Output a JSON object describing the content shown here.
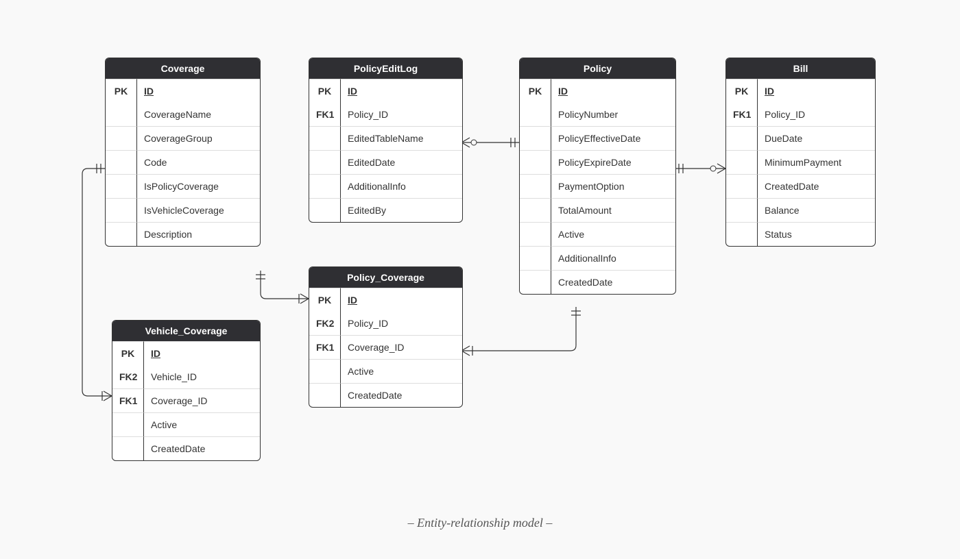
{
  "caption": "– Entity-relationship model –",
  "entities": {
    "coverage": {
      "title": "Coverage",
      "pk": {
        "key": "PK",
        "name": "ID"
      },
      "attrs": [
        {
          "key": "",
          "name": "CoverageName"
        },
        {
          "key": "",
          "name": "CoverageGroup"
        },
        {
          "key": "",
          "name": "Code"
        },
        {
          "key": "",
          "name": "IsPolicyCoverage"
        },
        {
          "key": "",
          "name": "IsVehicleCoverage"
        },
        {
          "key": "",
          "name": "Description"
        }
      ]
    },
    "policyEditLog": {
      "title": "PolicyEditLog",
      "pk": {
        "key": "PK",
        "name": "ID"
      },
      "attrs": [
        {
          "key": "FK1",
          "name": "Policy_ID"
        },
        {
          "key": "",
          "name": "EditedTableName"
        },
        {
          "key": "",
          "name": "EditedDate"
        },
        {
          "key": "",
          "name": "AdditionalInfo"
        },
        {
          "key": "",
          "name": "EditedBy"
        }
      ]
    },
    "policy": {
      "title": "Policy",
      "pk": {
        "key": "PK",
        "name": "ID"
      },
      "attrs": [
        {
          "key": "",
          "name": "PolicyNumber"
        },
        {
          "key": "",
          "name": "PolicyEffectiveDate"
        },
        {
          "key": "",
          "name": "PolicyExpireDate"
        },
        {
          "key": "",
          "name": "PaymentOption"
        },
        {
          "key": "",
          "name": "TotalAmount"
        },
        {
          "key": "",
          "name": "Active"
        },
        {
          "key": "",
          "name": "AdditionalInfo"
        },
        {
          "key": "",
          "name": "CreatedDate"
        }
      ]
    },
    "bill": {
      "title": "Bill",
      "pk": {
        "key": "PK",
        "name": "ID"
      },
      "attrs": [
        {
          "key": "FK1",
          "name": "Policy_ID"
        },
        {
          "key": "",
          "name": "DueDate"
        },
        {
          "key": "",
          "name": "MinimumPayment"
        },
        {
          "key": "",
          "name": "CreatedDate"
        },
        {
          "key": "",
          "name": "Balance"
        },
        {
          "key": "",
          "name": "Status"
        }
      ]
    },
    "vehicleCoverage": {
      "title": "Vehicle_Coverage",
      "pk": {
        "key": "PK",
        "name": "ID"
      },
      "attrs": [
        {
          "key": "FK2",
          "name": "Vehicle_ID"
        },
        {
          "key": "FK1",
          "name": "Coverage_ID"
        },
        {
          "key": "",
          "name": "Active"
        },
        {
          "key": "",
          "name": "CreatedDate"
        }
      ]
    },
    "policyCoverage": {
      "title": "Policy_Coverage",
      "pk": {
        "key": "PK",
        "name": "ID"
      },
      "attrs": [
        {
          "key": "FK2",
          "name": "Policy_ID"
        },
        {
          "key": "FK1",
          "name": "Coverage_ID"
        },
        {
          "key": "",
          "name": "Active"
        },
        {
          "key": "",
          "name": "CreatedDate"
        }
      ]
    }
  }
}
